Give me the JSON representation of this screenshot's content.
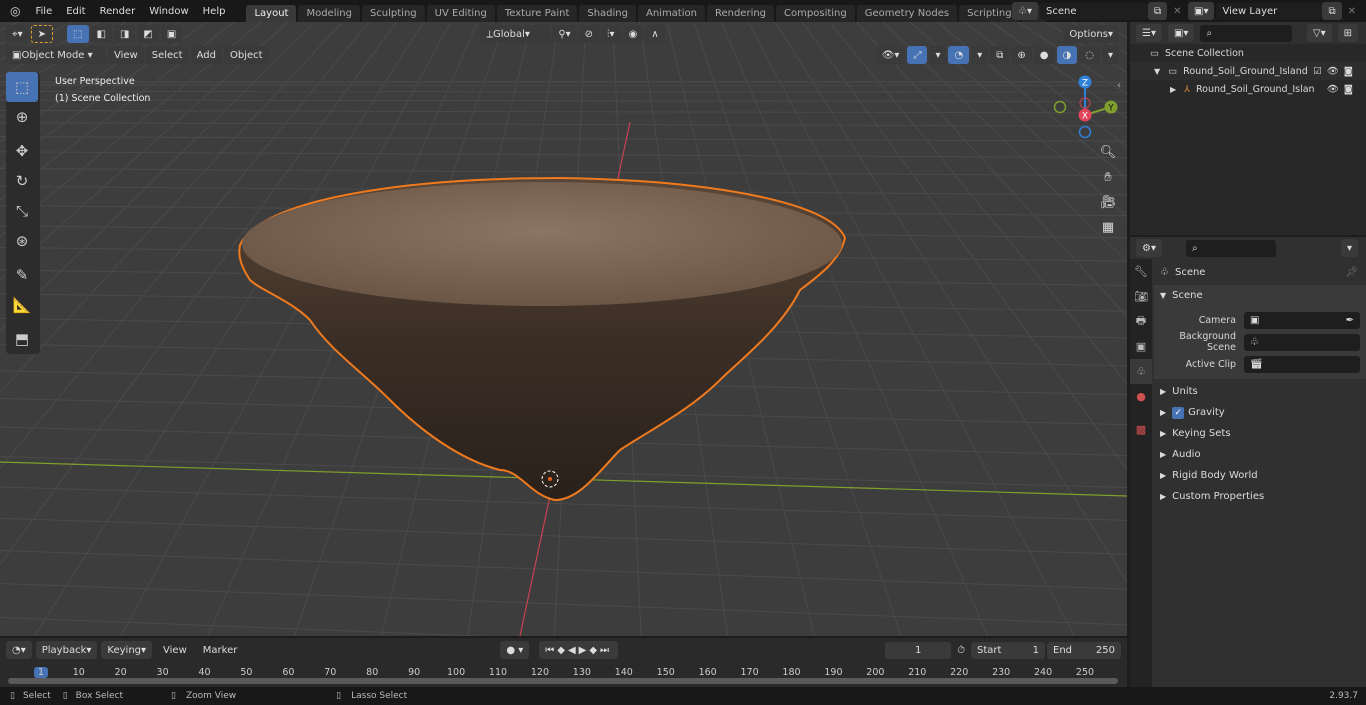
{
  "topbar": {
    "menus": [
      "File",
      "Edit",
      "Render",
      "Window",
      "Help"
    ],
    "workspaces": [
      "Layout",
      "Modeling",
      "Sculpting",
      "UV Editing",
      "Texture Paint",
      "Shading",
      "Animation",
      "Rendering",
      "Compositing",
      "Geometry Nodes",
      "Scripting"
    ],
    "active_workspace": "Layout",
    "scene": "Scene",
    "view_layer": "View Layer"
  },
  "viewport": {
    "mode": "Object Mode",
    "menus": [
      "View",
      "Select",
      "Add",
      "Object"
    ],
    "orientation": "Global",
    "options": "Options",
    "overlay_title": "User Perspective",
    "overlay_subtitle": "(1) Scene Collection",
    "gizmo": {
      "z": "Z",
      "y": "Y",
      "x": "X"
    },
    "tools": [
      "select-box",
      "cursor",
      "move",
      "rotate",
      "scale",
      "transform",
      "annotate",
      "measure",
      "add-cube"
    ]
  },
  "outliner": {
    "root": "Scene Collection",
    "items": [
      {
        "label": "Round_Soil_Ground_Island"
      },
      {
        "label": "Round_Soil_Ground_Islan"
      }
    ]
  },
  "properties": {
    "context": "Scene",
    "section": "Scene",
    "fields": [
      {
        "label": "Camera",
        "value": ""
      },
      {
        "label": "Background Scene",
        "value": ""
      },
      {
        "label": "Active Clip",
        "value": ""
      }
    ],
    "panels": [
      "Units",
      "Gravity",
      "Keying Sets",
      "Audio",
      "Rigid Body World",
      "Custom Properties"
    ],
    "gravity_checked": true
  },
  "timeline": {
    "menus": [
      "Playback",
      "Keying",
      "View",
      "Marker"
    ],
    "current_frame": "1",
    "start_label": "Start",
    "start": "1",
    "end_label": "End",
    "end": "250",
    "ticks": [
      "1",
      "10",
      "20",
      "30",
      "40",
      "50",
      "60",
      "70",
      "80",
      "90",
      "100",
      "110",
      "120",
      "130",
      "140",
      "150",
      "160",
      "170",
      "180",
      "190",
      "200",
      "210",
      "220",
      "230",
      "240",
      "250"
    ]
  },
  "status": {
    "hints": [
      "Select",
      "Box Select",
      "Zoom View",
      "Lasso Select"
    ],
    "version": "2.93.7"
  },
  "colors": {
    "accent": "#4772b3",
    "selection_outline": "#f07a1e",
    "x_axis": "#c8434f",
    "y_axis": "#7fa02d",
    "z_axis": "#2f80d8"
  }
}
